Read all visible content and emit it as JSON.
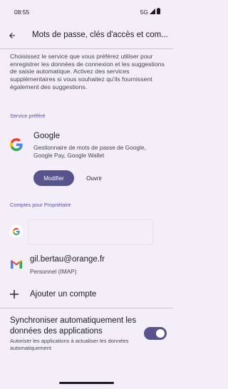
{
  "status_bar": {
    "time": "08:55",
    "network": "5G"
  },
  "header": {
    "title": "Mots de passe, clés d'accès et com..."
  },
  "intro": {
    "text": "Choisissez le service que vous préférez utiliser pour enregistrer les données de connexion et les suggestions de saisie automatique. Activez des services supplémentaires si vous souhaitez qu'ils fournissent également des suggestions."
  },
  "preferred_service": {
    "section_label": "Service préféré",
    "name": "Google",
    "description": "Gestionnaire de mots de passe de Google, Google Pay, Google Wallet",
    "modify_label": "Modifier",
    "open_label": "Ouvrir"
  },
  "accounts": {
    "section_label": "Comptes pour Propriétaire",
    "field_value": "",
    "gmail_email": "gil.bertau@orange.fr",
    "gmail_type": "Personnel (IMAP)",
    "add_label": "Ajouter un compte"
  },
  "sync": {
    "title": "Synchroniser automatiquement les données des applications",
    "description": "Autoriser les applications à actualiser les données automatiquement",
    "enabled": true
  },
  "colors": {
    "accent": "#57548d",
    "background": "#f3eef8",
    "section_label": "#5a52a6"
  },
  "icons": {
    "back": "arrow-back-icon",
    "google": "google-g-icon",
    "gmail": "gmail-icon",
    "add": "plus-icon",
    "signal": "signal-icon",
    "battery": "battery-icon"
  }
}
